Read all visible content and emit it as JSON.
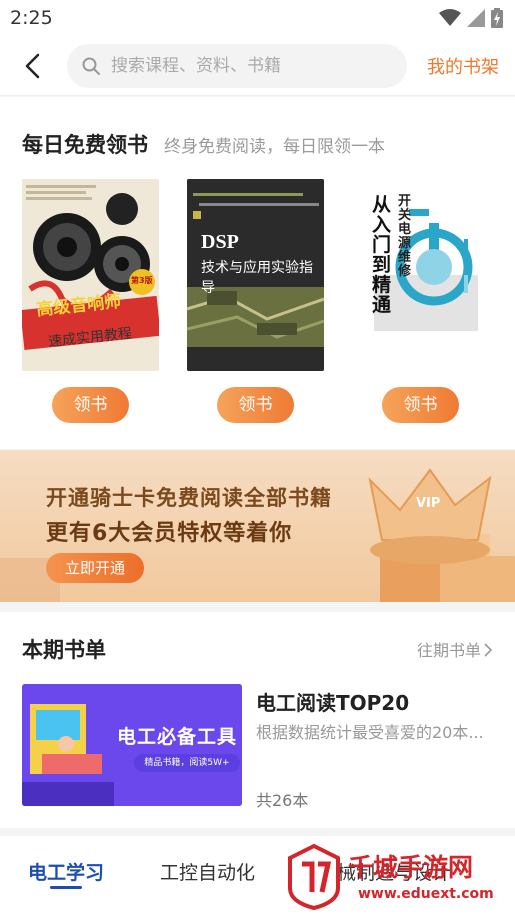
{
  "status": {
    "time": "2:25"
  },
  "header": {
    "search_placeholder": "搜索课程、资料、书籍",
    "my_shelf": "我的书架"
  },
  "free_books": {
    "title": "每日免费领书",
    "subtitle": "终身免费阅读，每日限领一本",
    "books": [
      {
        "cover_title": "高级音响师",
        "cover_subtitle": "速成实用教程",
        "edition": "第3版",
        "button": "领书"
      },
      {
        "cover_title": "DSP",
        "cover_subtitle": "技术与应用实验指导",
        "button": "领书"
      },
      {
        "cover_title": "开关电源维修",
        "cover_subtitle": "从入门到精通",
        "button": "领书"
      }
    ]
  },
  "banner": {
    "line1": "开通骑士卡免费阅读全部书籍",
    "line2": "更有6大会员特权等着你",
    "button": "立即开通",
    "badge": "VIP"
  },
  "booklist": {
    "title": "本期书单",
    "past_link": "往期书单",
    "cover_title": "电工必备工具",
    "cover_sub": "精品书籍，阅读5W+",
    "name": "电工阅读TOP20",
    "desc": "根据数据统计最受喜爱的20本...",
    "count": "共26本"
  },
  "tabs": {
    "items": [
      "电工学习",
      "工控自动化",
      "机械制造与设计"
    ],
    "active": "电工学习"
  },
  "watermark": {
    "text": "千城手游网",
    "url": "www.eduext.com"
  },
  "colors": {
    "accent_orange": "#ef7a34",
    "tab_blue": "#1a4fb0"
  }
}
